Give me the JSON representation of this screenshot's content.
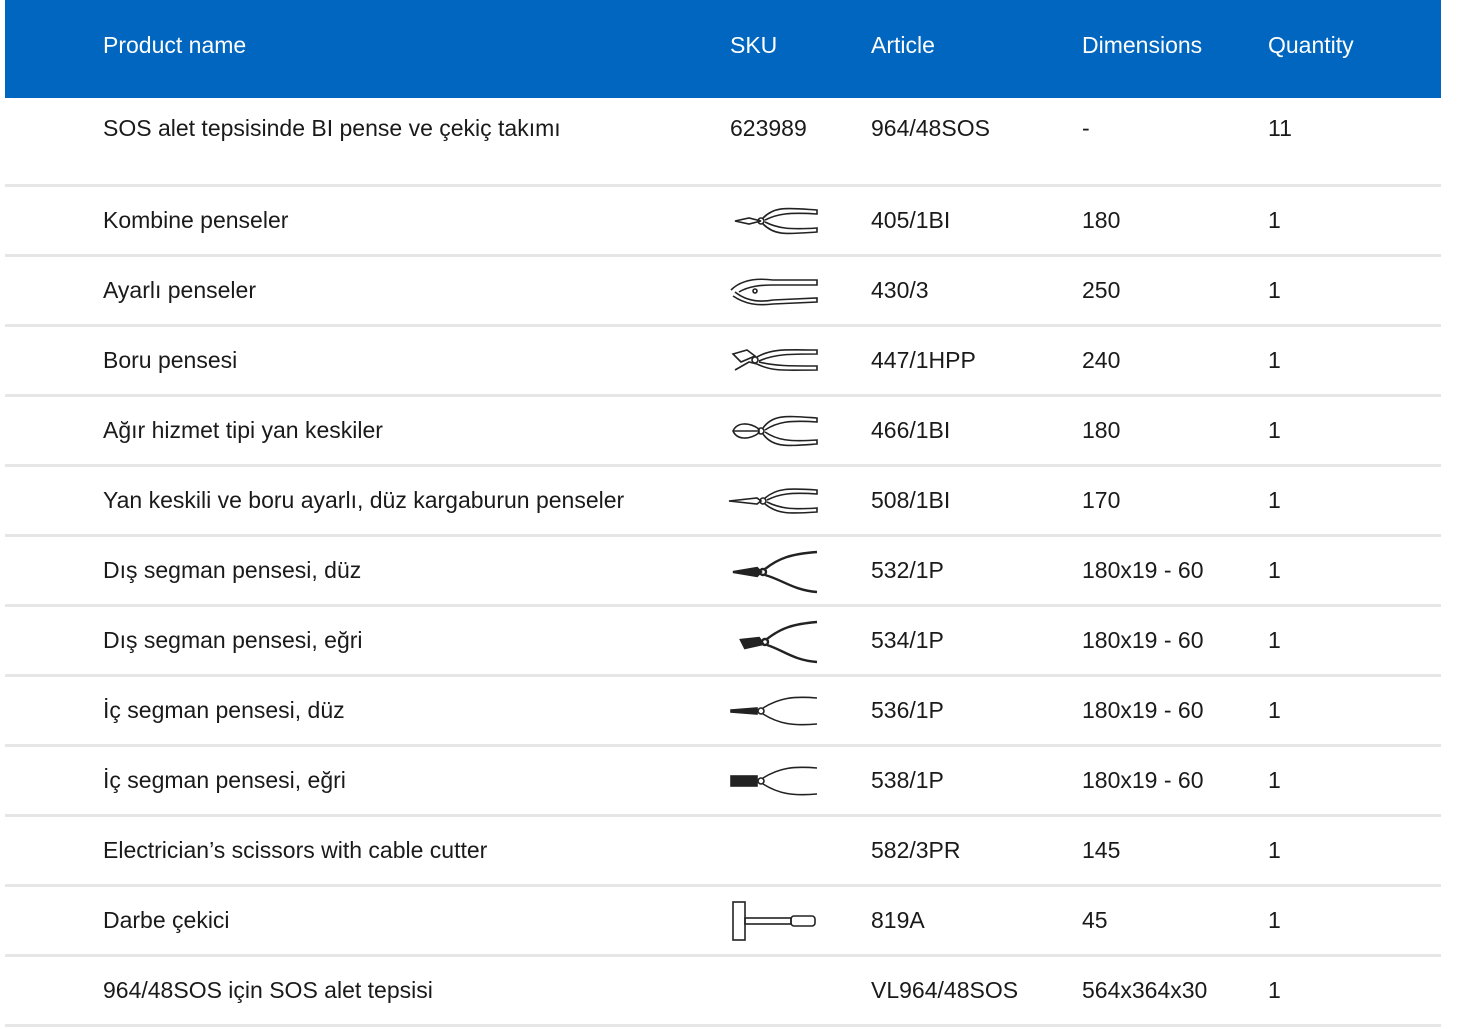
{
  "header": {
    "product_name": "Product name",
    "sku": "SKU",
    "article": "Article",
    "dimensions": "Dimensions",
    "quantity": "Quantity"
  },
  "rows": [
    {
      "name": "SOS alet tepsisinde BI pense ve çekiç takımı",
      "sku": "623989",
      "icon": "",
      "article": "964/48SOS",
      "dimensions": "-",
      "quantity": "11"
    },
    {
      "name": "Kombine penseler",
      "sku": "",
      "icon": "combination-pliers-icon",
      "article": "405/1BI",
      "dimensions": "180",
      "quantity": "1"
    },
    {
      "name": "Ayarlı penseler",
      "sku": "",
      "icon": "locking-pliers-icon",
      "article": "430/3",
      "dimensions": "250",
      "quantity": "1"
    },
    {
      "name": "Boru pensesi",
      "sku": "",
      "icon": "water-pump-pliers-icon",
      "article": "447/1HPP",
      "dimensions": "240",
      "quantity": "1"
    },
    {
      "name": "Ağır hizmet tipi yan keskiler",
      "sku": "",
      "icon": "side-cutter-icon",
      "article": "466/1BI",
      "dimensions": "180",
      "quantity": "1"
    },
    {
      "name": "Yan keskili ve boru ayarlı, düz kargaburun penseler",
      "sku": "",
      "icon": "long-nose-pliers-icon",
      "article": "508/1BI",
      "dimensions": "170",
      "quantity": "1"
    },
    {
      "name": "Dış segman pensesi, düz",
      "sku": "",
      "icon": "external-circlip-pliers-straight-icon",
      "article": "532/1P",
      "dimensions": "180x19 - 60",
      "quantity": "1"
    },
    {
      "name": "Dış segman pensesi, eğri",
      "sku": "",
      "icon": "external-circlip-pliers-bent-icon",
      "article": "534/1P",
      "dimensions": "180x19 - 60",
      "quantity": "1"
    },
    {
      "name": "İç segman pensesi, düz",
      "sku": "",
      "icon": "internal-circlip-pliers-straight-icon",
      "article": "536/1P",
      "dimensions": "180x19 - 60",
      "quantity": "1"
    },
    {
      "name": "İç segman pensesi, eğri",
      "sku": "",
      "icon": "internal-circlip-pliers-bent-icon",
      "article": "538/1P",
      "dimensions": "180x19 - 60",
      "quantity": "1"
    },
    {
      "name": "Electrician’s scissors with cable cutter",
      "sku": "",
      "icon": "",
      "article": "582/3PR",
      "dimensions": "145",
      "quantity": "1"
    },
    {
      "name": "Darbe çekici",
      "sku": "",
      "icon": "dead-blow-hammer-icon",
      "article": "819A",
      "dimensions": "45",
      "quantity": "1"
    },
    {
      "name": "964/48SOS için SOS alet tepsisi",
      "sku": "",
      "icon": "",
      "article": "VL964/48SOS",
      "dimensions": "564x364x30",
      "quantity": "1"
    }
  ],
  "colors": {
    "header_bg": "#0066bf",
    "header_text": "#ffffff",
    "divider": "#e6e6e6"
  }
}
